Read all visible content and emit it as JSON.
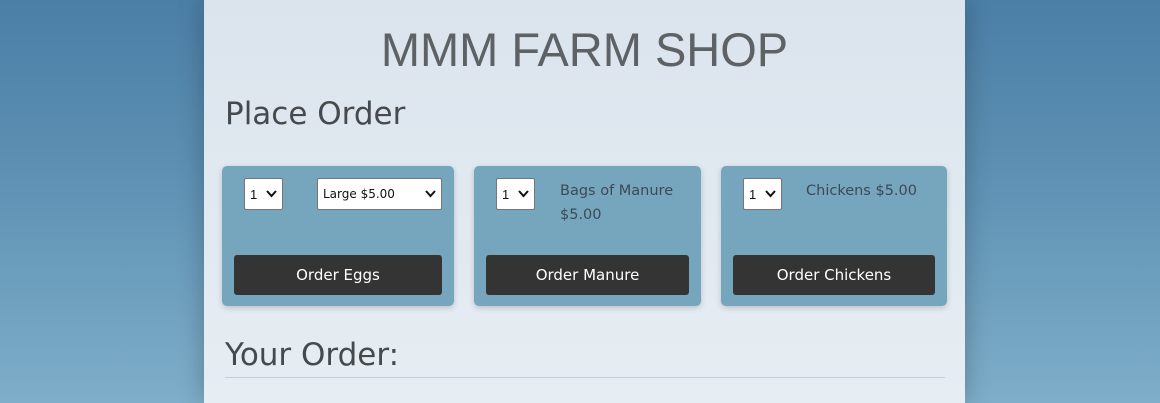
{
  "shop": {
    "title": "MMM FARM SHOP"
  },
  "place_order": {
    "title": "Place Order"
  },
  "products": {
    "eggs": {
      "quantity": "1",
      "size_selected": "Large $5.00",
      "button_label": "Order Eggs"
    },
    "manure": {
      "quantity": "1",
      "label": "Bags of Manure $5.00",
      "button_label": "Order Manure"
    },
    "chickens": {
      "quantity": "1",
      "label": "Chickens $5.00",
      "button_label": "Order Chickens"
    }
  },
  "your_order": {
    "title": "Your Order:"
  },
  "icons": {
    "dropdown": "chevron-down-icon"
  },
  "colors": {
    "card": "#76a5be",
    "button": "#343434",
    "panel": "#dbe4ed"
  }
}
